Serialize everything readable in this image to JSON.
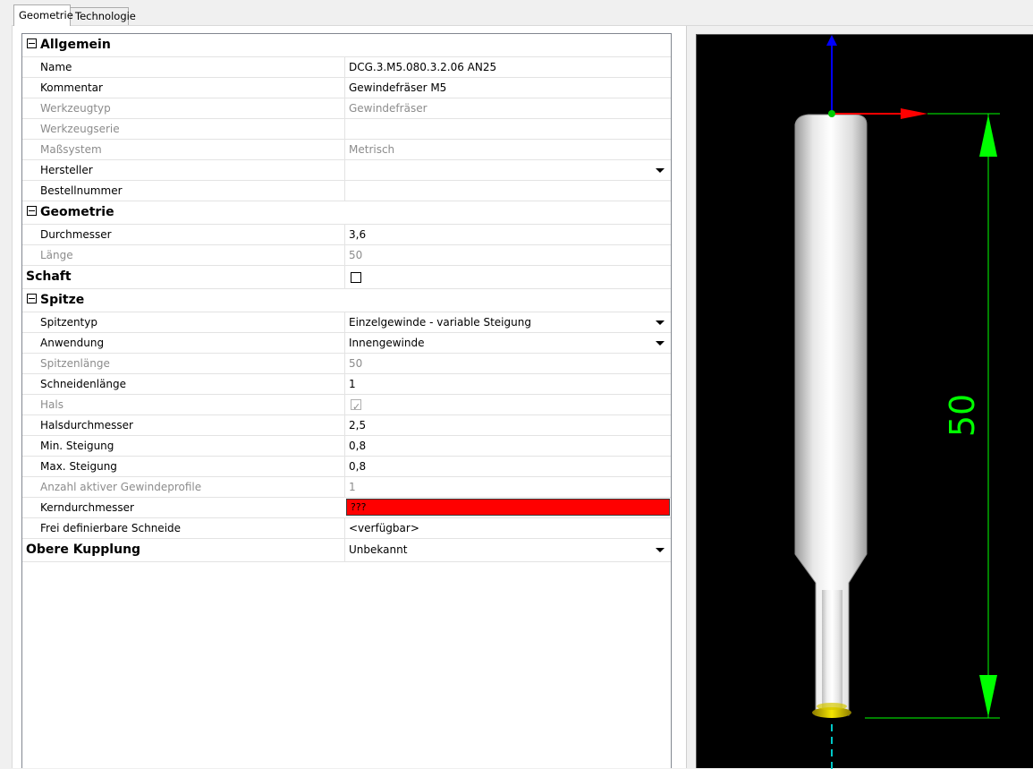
{
  "tabs": [
    {
      "label": "Geometrie",
      "active": true
    },
    {
      "label": "Technologie",
      "active": false
    }
  ],
  "properties": {
    "allgemein": {
      "header": "Allgemein",
      "rows": [
        {
          "name": "Name",
          "value": "DCG.3.M5.080.3.2.06 AN25"
        },
        {
          "name": "Kommentar",
          "value": "Gewindefräser M5"
        },
        {
          "name": "Werkzeugtyp",
          "value": "Gewindefräser"
        },
        {
          "name": "Werkzeugserie",
          "value": ""
        },
        {
          "name": "Maßsystem",
          "value": "Metrisch"
        },
        {
          "name": "Hersteller",
          "value": ""
        },
        {
          "name": "Bestellnummer",
          "value": ""
        }
      ]
    },
    "geometrie": {
      "header": "Geometrie",
      "rows": [
        {
          "name": "Durchmesser",
          "value": "3,6"
        },
        {
          "name": "Länge",
          "value": "50"
        }
      ]
    },
    "schaft": {
      "header": "Schaft",
      "checked": false
    },
    "spitze": {
      "header": "Spitze",
      "rows": [
        {
          "name": "Spitzentyp",
          "value": "Einzelgewinde - variable Steigung"
        },
        {
          "name": "Anwendung",
          "value": "Innengewinde"
        },
        {
          "name": "Spitzenlänge",
          "value": "50"
        },
        {
          "name": "Schneidenlänge",
          "value": "1"
        },
        {
          "name": "Hals",
          "value": ""
        },
        {
          "name": "Halsdurchmesser",
          "value": "2,5"
        },
        {
          "name": "Min. Steigung",
          "value": "0,8"
        },
        {
          "name": "Max. Steigung",
          "value": "0,8"
        },
        {
          "name": "Anzahl aktiver Gewindeprofile",
          "value": "1"
        },
        {
          "name": "Kerndurchmesser",
          "value": "???"
        },
        {
          "name": "Frei definierbare Schneide",
          "value": "<verfügbar>"
        }
      ]
    },
    "obere_kupplung": {
      "header": "Obere Kupplung",
      "value": "Unbekannt"
    }
  },
  "viewport": {
    "dimension_label": "50",
    "colors": {
      "background": "#000000",
      "dimension": "#00ff00",
      "axis_x": "#ff0000",
      "axis_y": "#0000ff",
      "axis_z": "#00cc00",
      "tool_tip": "#d8c800",
      "centerline": "#00c8c8"
    }
  }
}
